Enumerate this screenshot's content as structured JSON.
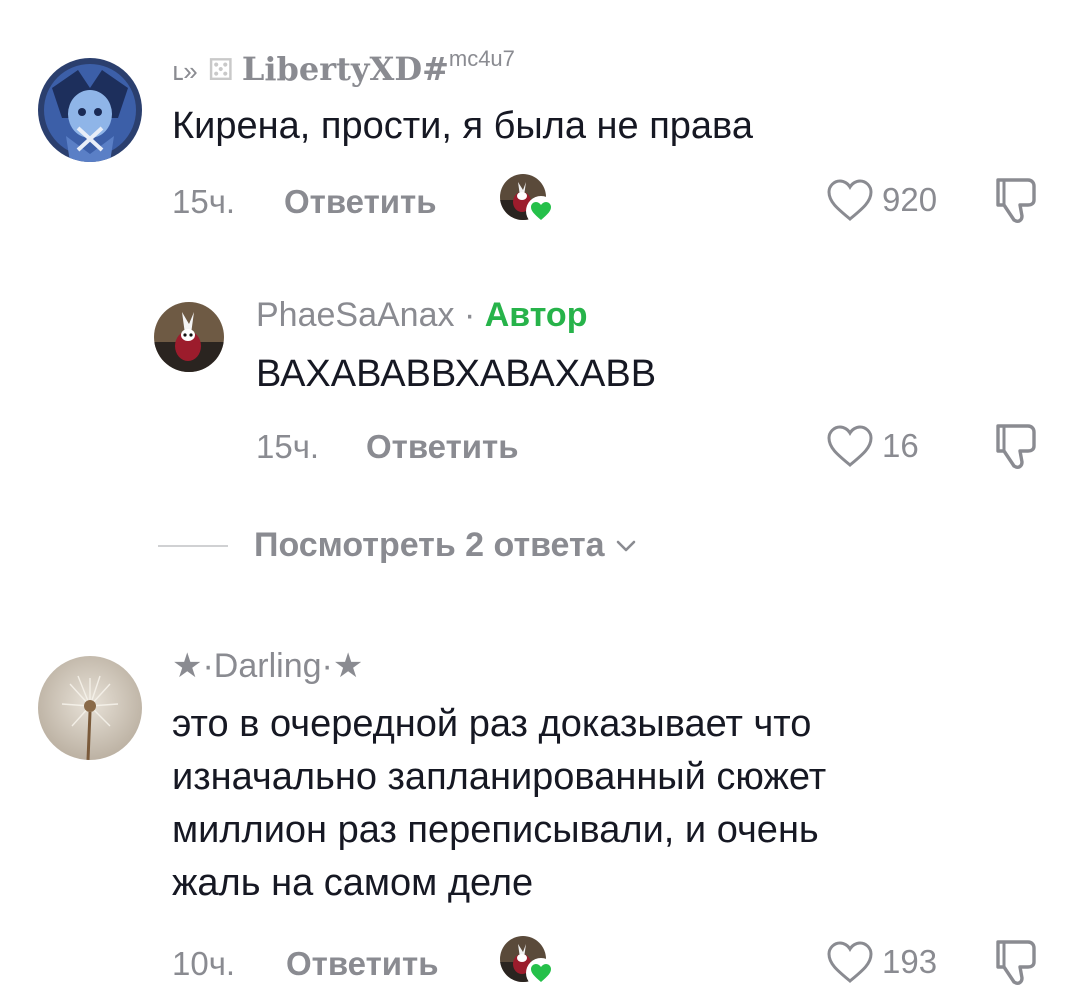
{
  "comments": [
    {
      "username_prefix": "ⳑ»",
      "username_dice": "⚄",
      "username_main": "LibertyXD#",
      "username_sup": "mc4u7",
      "text": "Кирена, прости, я была не права",
      "time": "15ч.",
      "reply_label": "Ответить",
      "likes": "920"
    },
    {
      "username": "PhaeSaAnax",
      "separator": " · ",
      "author_badge": "Автор",
      "text": "ВАХАВАВВХАВАХАВВ",
      "time": "15ч.",
      "reply_label": "Ответить",
      "likes": "16"
    },
    {
      "username": "★·Darling·★",
      "text": "это в очередной раз доказывает что\nизначально запланированный сюжет\nмиллион раз переписывали, и очень\nжаль на самом деле",
      "time": "10ч.",
      "reply_label": "Ответить",
      "likes": "193"
    }
  ],
  "view_replies_label": "Посмотреть 2 ответа",
  "colors": {
    "muted": "#8a8b91",
    "text": "#161823",
    "author_green": "#27b34a",
    "heart_green": "#25c04a"
  },
  "icons": [
    "heart-outline-icon",
    "dislike-icon",
    "chevron-down-icon",
    "creator-heart-icon",
    "dice-icon"
  ]
}
